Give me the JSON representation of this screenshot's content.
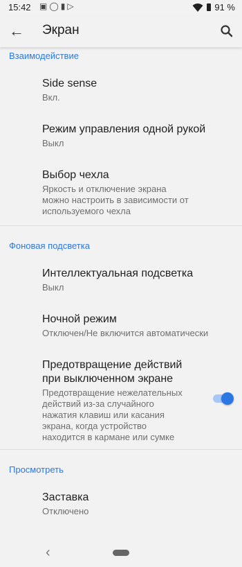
{
  "status_bar": {
    "time": "15:42",
    "battery": "91 %"
  },
  "app_bar": {
    "title": "Экран"
  },
  "sections": {
    "interaction": {
      "header": "Взаимодействие",
      "items": [
        {
          "title": "Side sense",
          "subtitle": "Вкл."
        },
        {
          "title": "Режим управления одной рукой",
          "subtitle": "Выкл"
        },
        {
          "title": "Выбор чехла",
          "subtitle_lines": [
            "Яркость и отключение экрана",
            "можно настроить в зависимости от",
            "используемого чехла"
          ]
        }
      ]
    },
    "backlight": {
      "header": "Фоновая подсветка",
      "items": [
        {
          "title": "Интеллектуальная подсветка",
          "subtitle": "Выкл"
        },
        {
          "title": "Ночной режим",
          "subtitle": "Отключен/Не включится автоматически"
        },
        {
          "title_lines": [
            "Предотвращение действий",
            "при выключенном экране"
          ],
          "subtitle_lines": [
            "Предотвращение нежелательных",
            "действий из-за случайного",
            "нажатия клавиш или касания",
            "экрана, когда устройство",
            "находится в кармане или сумке"
          ],
          "toggle_on": true
        }
      ]
    },
    "view": {
      "header": "Просмотреть",
      "items": [
        {
          "title": "Заставка",
          "subtitle": "Отключено"
        }
      ]
    }
  },
  "colors": {
    "accent": "#2b77e4",
    "background": "#f2f2f2"
  }
}
